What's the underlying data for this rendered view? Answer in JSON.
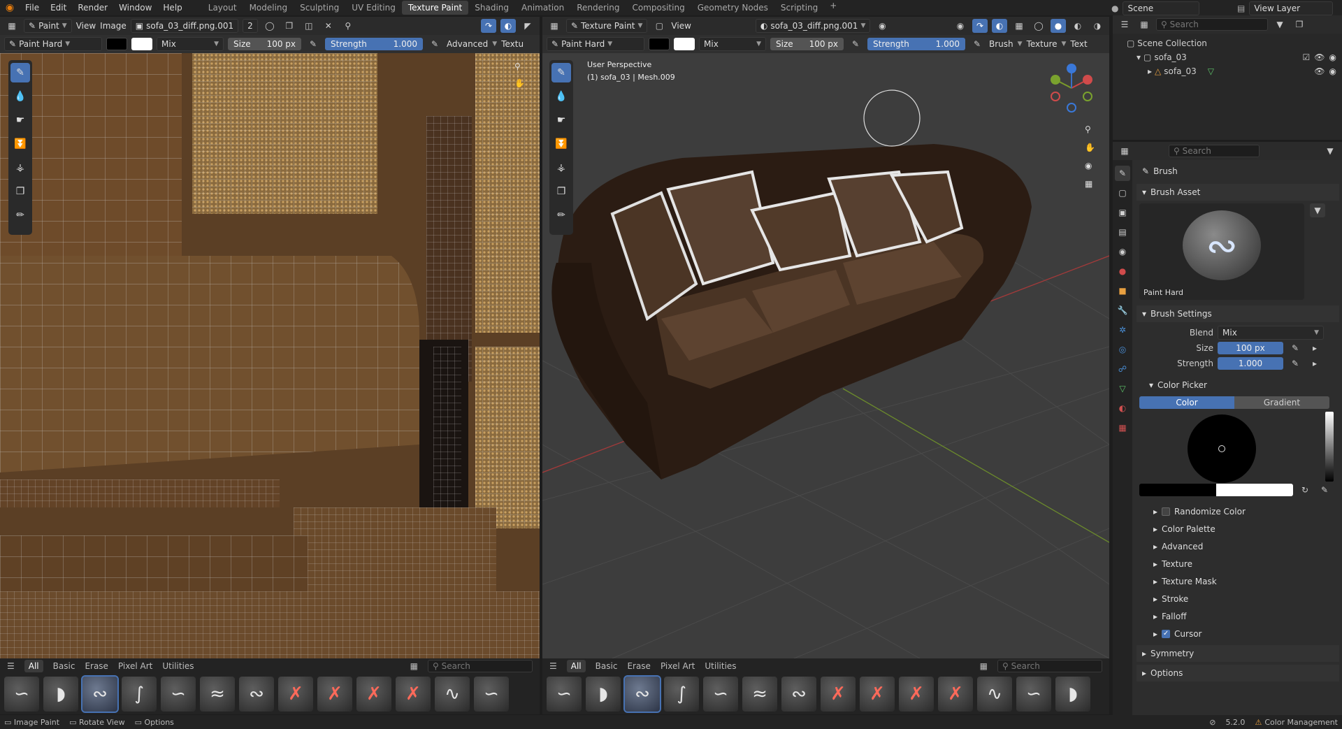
{
  "app": {
    "accent": "#4772b3",
    "logo_color": "#e87d0d"
  },
  "topbar": {
    "menus": [
      "File",
      "Edit",
      "Render",
      "Window",
      "Help"
    ],
    "workspaces": [
      "Layout",
      "Modeling",
      "Sculpting",
      "UV Editing",
      "Texture Paint",
      "Shading",
      "Animation",
      "Rendering",
      "Compositing",
      "Geometry Nodes",
      "Scripting"
    ],
    "active_workspace": "Texture Paint",
    "scene": "Scene",
    "view_layer": "View Layer"
  },
  "image_editor": {
    "mode": "Paint",
    "menus": [
      "View",
      "Image"
    ],
    "image_name": "sofa_03_diff.png.001",
    "user_count": "2",
    "brush": "Paint Hard",
    "blend": "Mix",
    "size_label": "Size",
    "size_value": "100 px",
    "strength_label": "Strength",
    "strength_value": "1.000",
    "advanced": "Advanced",
    "texture": "Textu"
  },
  "viewport": {
    "mode": "Texture Paint",
    "view_menu": "View",
    "image_name": "sofa_03_diff.png.001",
    "brush": "Paint Hard",
    "blend": "Mix",
    "size_label": "Size",
    "size_value": "100 px",
    "strength_label": "Strength",
    "strength_value": "1.000",
    "brush_menu": "Brush",
    "texture_menu": "Texture",
    "text_menu": "Text",
    "overlay_title": "User Perspective",
    "overlay_object": "(1) sofa_03 | Mesh.009"
  },
  "asset_shelf": {
    "tabs": [
      "All",
      "Basic",
      "Erase",
      "Pixel Art",
      "Utilities"
    ],
    "active": "All",
    "search_placeholder": "Search"
  },
  "outliner": {
    "search_placeholder": "Search",
    "collection": "Scene Collection",
    "items": [
      "sofa_03",
      "sofa_03"
    ]
  },
  "properties": {
    "search_placeholder": "Search",
    "context": "Brush",
    "brush_asset_header": "Brush Asset",
    "brush_asset_name": "Paint Hard",
    "brush_settings_header": "Brush Settings",
    "blend_label": "Blend",
    "blend_value": "Mix",
    "size_label": "Size",
    "size_value": "100 px",
    "strength_label": "Strength",
    "strength_value": "1.000",
    "color_picker_header": "Color Picker",
    "color_tab": "Color",
    "gradient_tab": "Gradient",
    "subpanels": [
      "Randomize Color",
      "Color Palette",
      "Advanced",
      "Texture",
      "Texture Mask",
      "Stroke",
      "Falloff",
      "Cursor"
    ],
    "symmetry": "Symmetry",
    "options": "Options"
  },
  "status": {
    "items": [
      "Image Paint",
      "Rotate View",
      "Options"
    ],
    "version": "5.2.0",
    "color_management": "Color Management"
  }
}
